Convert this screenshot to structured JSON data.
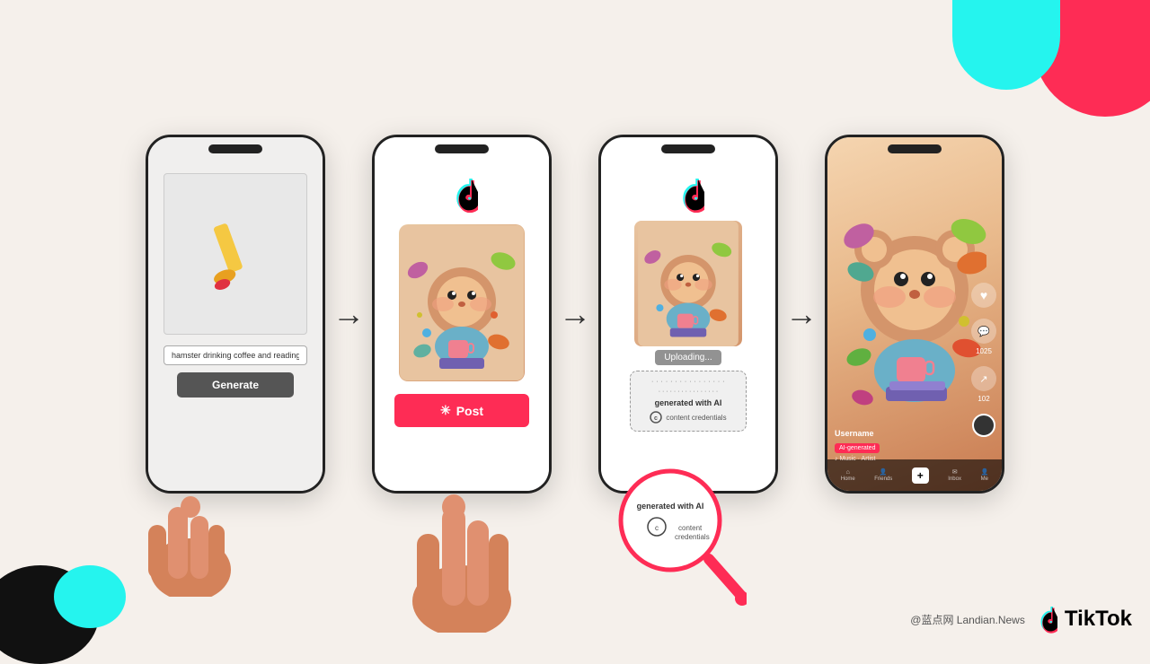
{
  "page": {
    "background_color": "#f5f0eb"
  },
  "decorative": {
    "blobs": [
      "top-right-red",
      "top-right-cyan",
      "bottom-left-black",
      "bottom-left-cyan"
    ]
  },
  "phone1": {
    "type": "ai_generator",
    "input_value": "hamster drinking coffee and reading",
    "input_placeholder": "hamster drinking coffee and reading",
    "generate_btn": "Generate"
  },
  "phone2": {
    "type": "tiktok_post",
    "tiktok_logo": "♪",
    "post_btn": "Post",
    "post_icon": "✳"
  },
  "phone3": {
    "type": "uploading",
    "tiktok_logo": "♪",
    "upload_label": "Uploading...",
    "generated_with_ai": "generated with AI",
    "credential_badge": "content credentials"
  },
  "phone4": {
    "type": "tiktok_feed",
    "username": "Username",
    "ai_badge": "AI-generated",
    "music": "♪ Music · Artist",
    "nav_items": [
      "Home",
      "Friends",
      "+",
      "Inbox",
      "Me"
    ],
    "like_count": "",
    "comment_count": "1025",
    "share_count": "102"
  },
  "footer": {
    "site": "@蓝点网 Landian.News",
    "brand": "TikTok"
  },
  "arrows": [
    "→",
    "→",
    "→"
  ]
}
